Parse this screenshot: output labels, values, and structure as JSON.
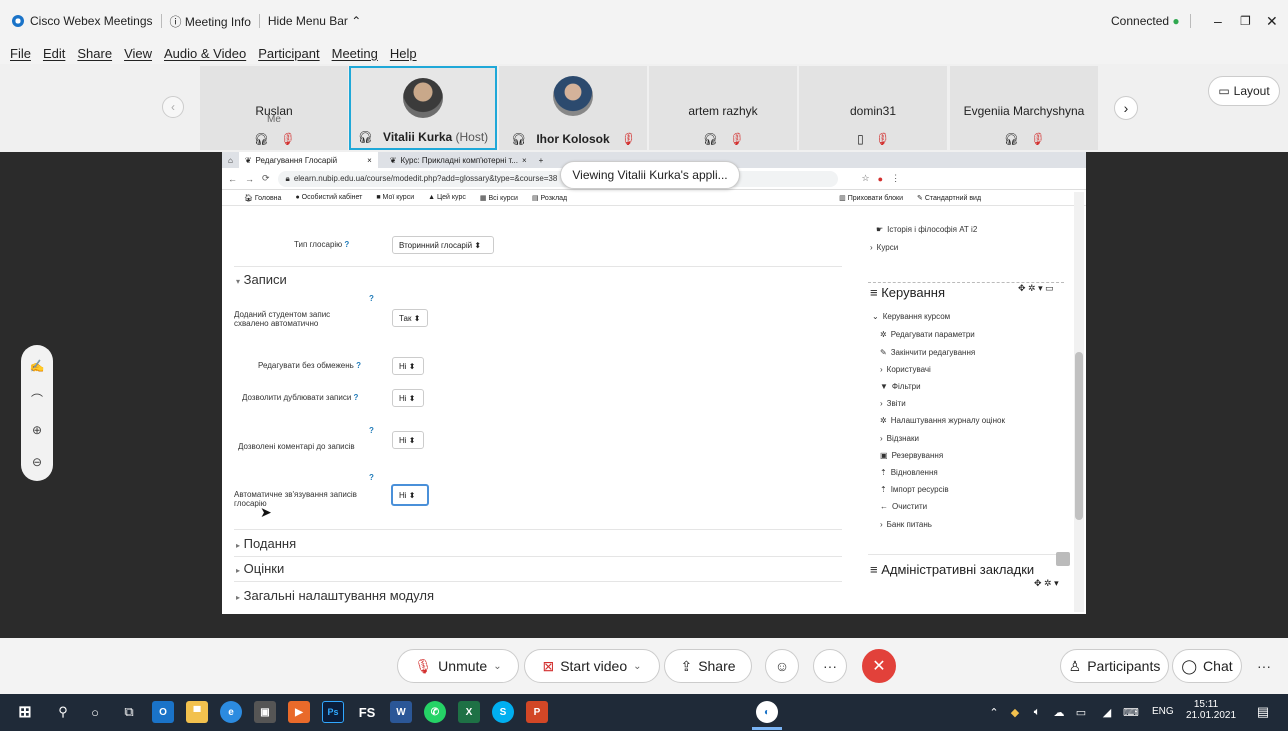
{
  "titlebar": {
    "app": "Cisco Webex Meetings",
    "meeting_info": "Meeting Info",
    "hide_menu": "Hide Menu Bar",
    "status": "Connected"
  },
  "menu": [
    "File",
    "Edit",
    "Share",
    "View",
    "Audio & Video",
    "Participant",
    "Meeting",
    "Help"
  ],
  "layout_label": "Layout",
  "participants": [
    {
      "name": "Ruslan",
      "sub": "Me"
    },
    {
      "name": "Vitalii Kurka",
      "role": "(Host)"
    },
    {
      "name": "Ihor Kolosok"
    },
    {
      "name": "artem razhyk"
    },
    {
      "name": "domin31"
    },
    {
      "name": "Evgeniia Marchyshyna"
    }
  ],
  "viewing_banner": "Viewing Vitalii Kurka's appli...",
  "browser": {
    "tab1": "Редагування Глосарій",
    "tab2": "Курс: Прикладні комп'ютерні т...",
    "url": "elearn.nubip.edu.ua/course/modedit.php?add=glossary&type=&course=38",
    "bookmarks": [
      "Головна",
      "Особистий кабінет",
      "Мої курси",
      "Цей курс",
      "Всі курси",
      "Розклад"
    ],
    "bookmarks_right": [
      "Приховати блоки",
      "Стандартний вид"
    ]
  },
  "form": {
    "glossary_type_label": "Тип глосарію",
    "glossary_type_value": "Вторинний глосарій",
    "section_entries": "Записи",
    "auto_approve_label_1": "Доданий студентом запис",
    "auto_approve_label_2": "схвалено автоматично",
    "auto_approve_value": "Так",
    "edit_unlimited_label": "Редагувати без обмежень",
    "edit_unlimited_value": "Ні",
    "allow_duplicates_label": "Дозволити дублювати записи",
    "allow_duplicates_value": "Ні",
    "allow_comments_label": "Дозволені коментарі до записів",
    "allow_comments_value": "Ні",
    "autolink_label_1": "Автоматичне зв'язування записів",
    "autolink_label_2": "глосарію",
    "autolink_value": "Ні",
    "section_appearance": "Подання",
    "section_grades": "Оцінки",
    "section_general": "Загальні налаштування модуля"
  },
  "sidebar": {
    "history_item": "Історія і філософія АТ і2",
    "courses": "Курси",
    "admin_title": "Керування",
    "course_admin": "Керування курсом",
    "items": [
      "Редагувати параметри",
      "Закінчити редагування",
      "Користувачі",
      "Фільтри",
      "Звіти",
      "Налаштування журналу оцінок",
      "Відзнаки",
      "Резервування",
      "Відновлення",
      "Імпорт ресурсів",
      "Очистити",
      "Банк питань"
    ],
    "admin_bookmarks": "Адміністративні закладки"
  },
  "controls": {
    "unmute": "Unmute",
    "start_video": "Start video",
    "share": "Share",
    "participants": "Participants",
    "chat": "Chat"
  },
  "taskbar": {
    "lang": "ENG",
    "time": "15:11",
    "date": "21.01.2021"
  }
}
